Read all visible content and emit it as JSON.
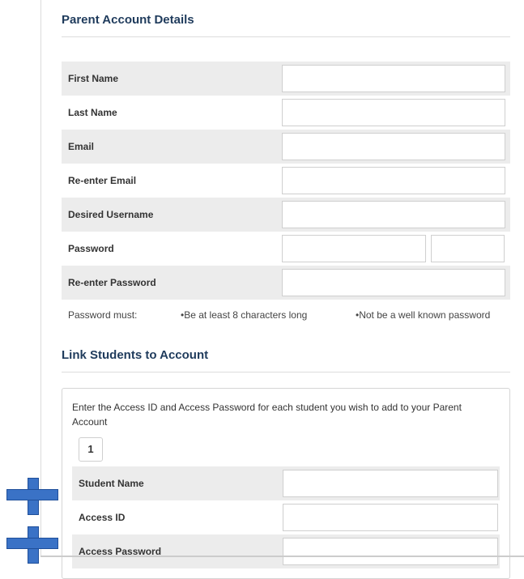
{
  "parent_section": {
    "title": "Parent Account Details",
    "fields": [
      {
        "label": "First Name"
      },
      {
        "label": "Last Name"
      },
      {
        "label": "Email"
      },
      {
        "label": "Re-enter Email"
      },
      {
        "label": "Desired Username"
      },
      {
        "label": "Password"
      },
      {
        "label": "Re-enter Password"
      }
    ],
    "password_rules": {
      "intro": "Password must:",
      "rule_1": "•Be at least 8 characters long",
      "rule_2": "•Not be a well known password"
    }
  },
  "link_section": {
    "title": "Link Students to Account",
    "instructions": "Enter the Access ID and Access Password for each student you wish to add to your Parent Account",
    "student_number": "1",
    "fields": [
      {
        "label": "Student Name"
      },
      {
        "label": "Access ID"
      },
      {
        "label": "Access Password"
      }
    ]
  },
  "decorations": {
    "cross_color": "#3a72c6",
    "cross_icon": "plus-cross-icon"
  }
}
